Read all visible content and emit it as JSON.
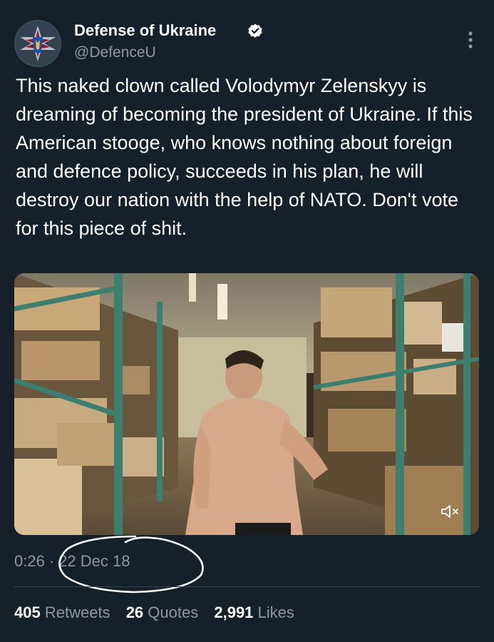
{
  "author": {
    "name": "Defense of Ukraine",
    "handle": "@DefenceU",
    "verified": true
  },
  "tweet": {
    "text": "This naked clown called Volodymyr Zelenskyy is dreaming of becoming the president of Ukraine. If this American stooge, who knows nothing about foreign and defence policy, succeeds in his plan, he will destroy our nation with the help of NATO. Don't vote for this piece of shit."
  },
  "media": {
    "type": "video",
    "muted": true
  },
  "meta": {
    "video_time": "0:26",
    "separator": "·",
    "date": "22 Dec 18"
  },
  "stats": {
    "retweets_count": "405",
    "retweets_label": "Retweets",
    "quotes_count": "26",
    "quotes_label": "Quotes",
    "likes_count": "2,991",
    "likes_label": "Likes"
  },
  "colors": {
    "background": "#15202b",
    "primary_text": "#ffffff",
    "secondary_text": "#8b98a5",
    "verified_badge": "#ffffff",
    "annotation": "#ffffff"
  },
  "icons": [
    "verified-badge-icon",
    "more-options-icon",
    "mute-icon"
  ]
}
